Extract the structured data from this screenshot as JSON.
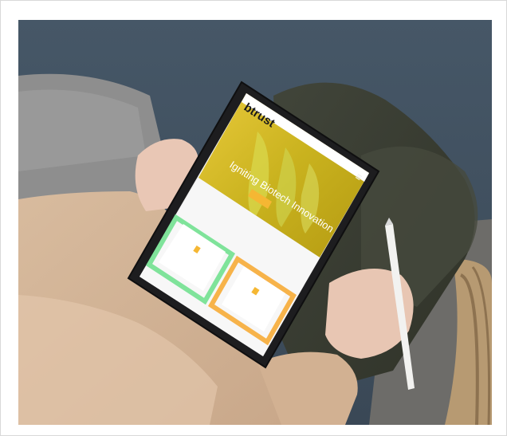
{
  "tablet_screen": {
    "logo": "btrust",
    "hero_title": "Igniting Biotech Innovation",
    "menu_icon": "hamburger-icon",
    "card_icons": [
      "columns-icon",
      "flask-icon"
    ]
  },
  "colors": {
    "brand_yellow": "#f2c320",
    "card_green": "#7fe39a",
    "card_orange": "#f7b34a",
    "cta": "#f5b733",
    "background_wall": "#3f4e5c",
    "pants": "#3b3f30",
    "sweater": "#d9bca0"
  }
}
